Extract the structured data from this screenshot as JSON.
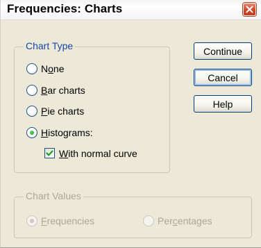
{
  "window": {
    "title": "Frequencies: Charts",
    "close_icon": "close-x-icon"
  },
  "chart_type": {
    "group_label": "Chart Type",
    "options": [
      {
        "label_pre": "N",
        "label_key": "o",
        "label_post": "ne",
        "selected": false
      },
      {
        "label_pre": "",
        "label_key": "B",
        "label_post": "ar charts",
        "selected": false
      },
      {
        "label_pre": "",
        "label_key": "P",
        "label_post": "ie charts",
        "selected": false
      },
      {
        "label_pre": "",
        "label_key": "H",
        "label_post": "istograms:",
        "selected": true
      }
    ],
    "normal_curve": {
      "label_pre": "",
      "label_key": "W",
      "label_post": "ith normal curve",
      "checked": true
    }
  },
  "chart_values": {
    "group_label": "Chart Values",
    "enabled": false,
    "options": [
      {
        "label_pre": "",
        "label_key": "F",
        "label_post": "requencies",
        "selected": true
      },
      {
        "label_pre": "Per",
        "label_key": "c",
        "label_post": "entages",
        "selected": false
      }
    ]
  },
  "buttons": {
    "continue": "Continue",
    "cancel": "Cancel",
    "help": "Help"
  }
}
